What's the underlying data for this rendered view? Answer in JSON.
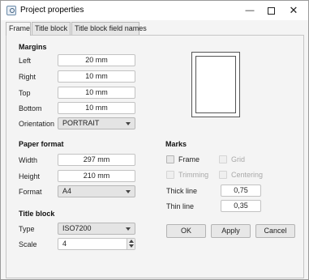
{
  "window": {
    "title": "Project properties",
    "minimize": "—",
    "close": "✕"
  },
  "tabs": [
    "Frame",
    "Title block",
    "Title block field names"
  ],
  "margins": {
    "heading": "Margins",
    "left_label": "Left",
    "left_value": "20 mm",
    "right_label": "Right",
    "right_value": "10 mm",
    "top_label": "Top",
    "top_value": "10 mm",
    "bottom_label": "Bottom",
    "bottom_value": "10 mm",
    "orientation_label": "Orientation",
    "orientation_value": "PORTRAIT"
  },
  "paper_format": {
    "heading": "Paper format",
    "width_label": "Width",
    "width_value": "297 mm",
    "height_label": "Height",
    "height_value": "210 mm",
    "format_label": "Format",
    "format_value": "A4"
  },
  "title_block": {
    "heading": "Title block",
    "type_label": "Type",
    "type_value": "ISO7200",
    "scale_label": "Scale",
    "scale_value": "4"
  },
  "marks": {
    "heading": "Marks",
    "frame_label": "Frame",
    "grid_label": "Grid",
    "trimming_label": "Trimming",
    "centering_label": "Centering",
    "thick_line_label": "Thick line",
    "thick_line_value": "0,75",
    "thin_line_label": "Thin line",
    "thin_line_value": "0,35"
  },
  "buttons": {
    "ok": "OK",
    "apply": "Apply",
    "cancel": "Cancel"
  }
}
